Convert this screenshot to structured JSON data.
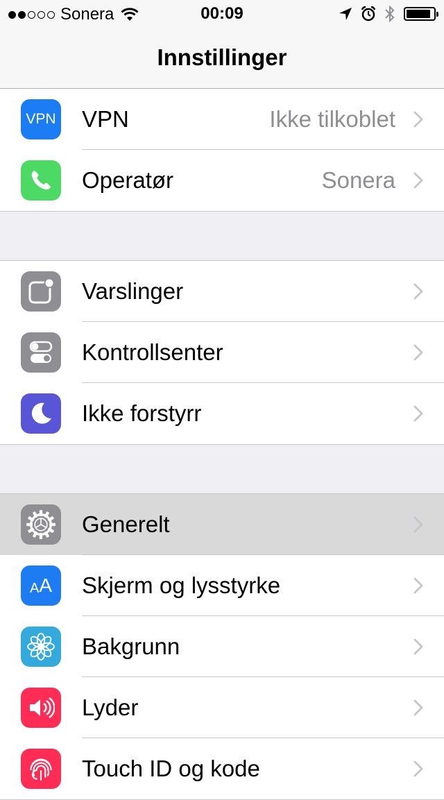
{
  "status_bar": {
    "carrier": "Sonera",
    "time": "00:09",
    "signal": {
      "filled": 2,
      "total": 5
    },
    "battery_level": 0.9
  },
  "nav": {
    "title": "Innstillinger"
  },
  "colors": {
    "vpn": "#1b7cf3",
    "operator": "#4cd964",
    "gray": "#8e8e93",
    "dnd": "#5856d6",
    "display": "#1e7cf2",
    "wallpaper": "#34aadc",
    "sounds": "#ff2d55",
    "touchid": "#ff2d55"
  },
  "groups": [
    [
      {
        "label": "VPN",
        "detail": "Ikke tilkoblet",
        "icon": "vpn-icon",
        "icon_text": "VPN"
      },
      {
        "label": "Operatør",
        "detail": "Sonera",
        "icon": "phone-icon"
      }
    ],
    [
      {
        "label": "Varslinger",
        "icon": "notifications-icon"
      },
      {
        "label": "Kontrollsenter",
        "icon": "control-center-icon"
      },
      {
        "label": "Ikke forstyrr",
        "icon": "moon-icon"
      }
    ],
    [
      {
        "label": "Generelt",
        "icon": "gear-icon",
        "highlighted": true
      },
      {
        "label": "Skjerm og lysstyrke",
        "icon": "display-icon",
        "icon_text": "AA"
      },
      {
        "label": "Bakgrunn",
        "icon": "wallpaper-icon"
      },
      {
        "label": "Lyder",
        "icon": "speaker-icon"
      },
      {
        "label": "Touch ID og kode",
        "icon": "fingerprint-icon"
      }
    ]
  ]
}
